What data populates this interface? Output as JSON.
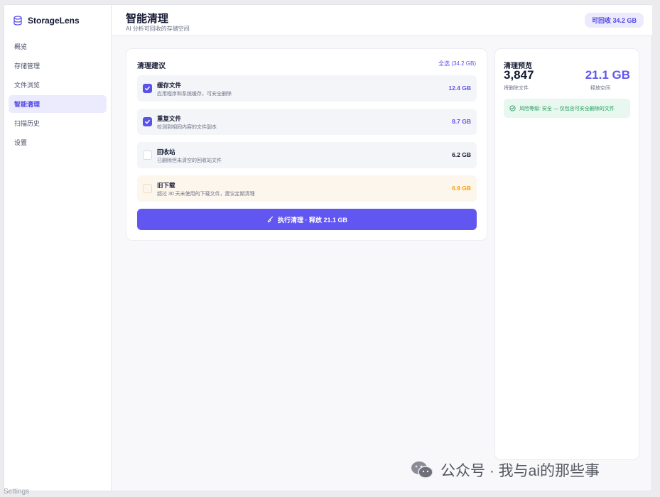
{
  "app": {
    "name": "StorageLens"
  },
  "sidebar": {
    "items": [
      {
        "label": "概览"
      },
      {
        "label": "存储管理"
      },
      {
        "label": "文件浏览"
      },
      {
        "label": "智能清理"
      },
      {
        "label": "扫描历史"
      },
      {
        "label": "设置"
      }
    ],
    "active_index": 3
  },
  "header": {
    "title": "智能清理",
    "subtitle": "AI 分析可回收的存储空间",
    "badge": "可回收 34.2 GB"
  },
  "suggestions": {
    "title": "清理建议",
    "select_all": "全选 (34.2 GB)",
    "items": [
      {
        "name": "缓存文件",
        "desc": "应用程序和系统缓存，可安全删除",
        "size": "12.4 GB",
        "checked": true,
        "size_color": "#5b52e8"
      },
      {
        "name": "重复文件",
        "desc": "检测到相同内容的文件副本",
        "size": "8.7 GB",
        "checked": true,
        "size_color": "#5b52e8"
      },
      {
        "name": "回收站",
        "desc": "已删除但未清空的回收站文件",
        "size": "6.2 GB",
        "checked": false,
        "size_color": "#141a33"
      },
      {
        "name": "旧下载",
        "desc": "超过 30 天未使用的下载文件，建议定期清理",
        "size": "6.9 GB",
        "checked": false,
        "size_color": "#f0a11a"
      }
    ],
    "run_button": "执行清理 · 释放 21.1 GB"
  },
  "preview": {
    "title": "清理预览",
    "files_count": "3,847",
    "files_label": "将删除文件",
    "space": "21.1 GB",
    "space_label": "释放空间",
    "risk_text": "风险等级: 安全 — 仅包含可安全删除的文件"
  },
  "watermark": "公众号 · 我与ai的那些事",
  "footer": "Settings",
  "colors": {
    "accent": "#6156f0",
    "success": "#1f9d5b",
    "warning": "#f0a11a"
  }
}
